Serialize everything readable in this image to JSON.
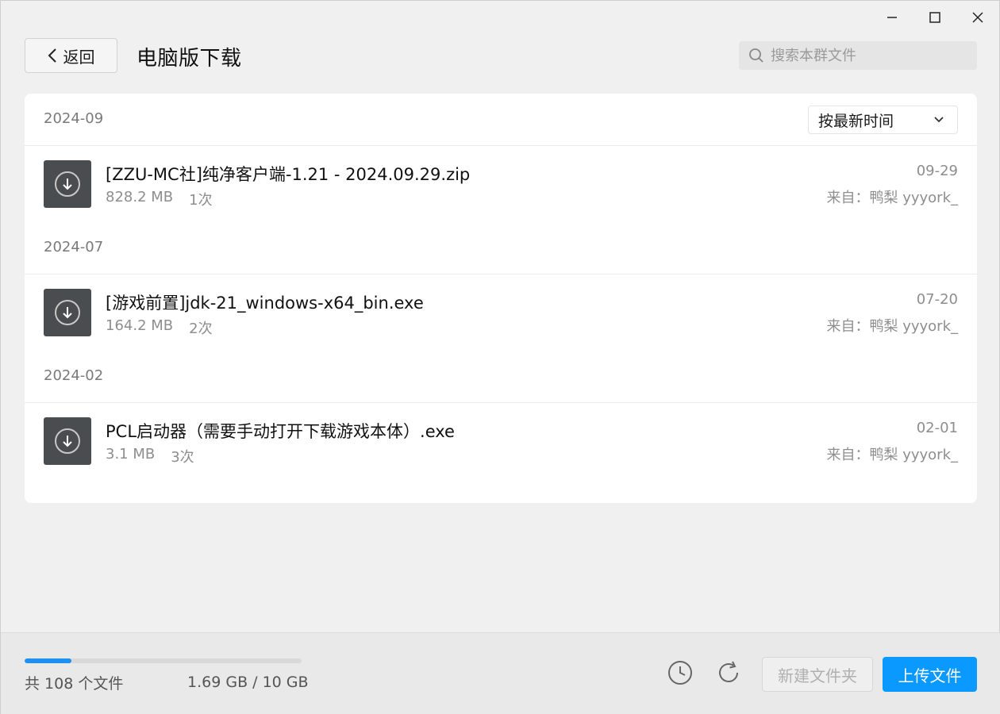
{
  "header": {
    "back_label": "返回",
    "title": "电脑版下载",
    "search_placeholder": "搜索本群文件"
  },
  "sort": {
    "selected": "按最新时间"
  },
  "groups": [
    {
      "date": "2024-09",
      "files": [
        {
          "name": "[ZZU-MC社]纯净客户端-1.21 - 2024.09.29.zip",
          "size": "828.2 MB",
          "downloads": "1次",
          "date": "09-29",
          "from": "来自：鸭梨 yyyork_"
        }
      ]
    },
    {
      "date": "2024-07",
      "files": [
        {
          "name": "[游戏前置]jdk-21_windows-x64_bin.exe",
          "size": "164.2 MB",
          "downloads": "2次",
          "date": "07-20",
          "from": "来自：鸭梨 yyyork_"
        }
      ]
    },
    {
      "date": "2024-02",
      "files": [
        {
          "name": "PCL启动器（需要手动打开下载游戏本体）.exe",
          "size": "3.1 MB",
          "downloads": "3次",
          "date": "02-01",
          "from": "来自：鸭梨 yyyork_"
        }
      ]
    }
  ],
  "footer": {
    "file_count": "共 108 个文件",
    "storage": "1.69 GB / 10 GB",
    "storage_used_fraction": 0.169,
    "new_folder_label": "新建文件夹",
    "upload_label": "上传文件"
  },
  "colors": {
    "accent": "#0a99ff",
    "progress": "#1e90f0",
    "file_icon_bg": "#4a4d50"
  },
  "icons": {
    "minimize": "minimize-icon",
    "maximize": "maximize-icon",
    "close": "close-icon",
    "back": "chevron-left-icon",
    "search": "search-icon",
    "sort": "chevron-down-icon",
    "file": "download-icon",
    "history": "clock-icon",
    "refresh": "refresh-icon"
  }
}
